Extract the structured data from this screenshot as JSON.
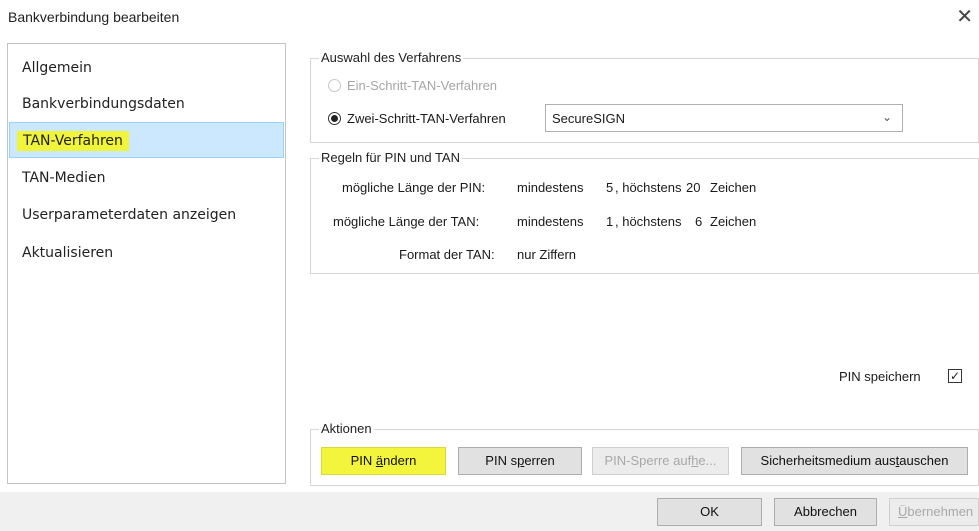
{
  "window": {
    "title": "Bankverbindung bearbeiten",
    "close_glyph": "✕"
  },
  "sidebar": {
    "items": [
      {
        "label": "Allgemein"
      },
      {
        "label": "Bankverbindungsdaten"
      },
      {
        "label": "TAN-Verfahren",
        "selected": true
      },
      {
        "label": "TAN-Medien"
      },
      {
        "label": "Userparameterdaten anzeigen"
      },
      {
        "label": "Aktualisieren"
      }
    ]
  },
  "verfahren": {
    "legend": "Auswahl des Verfahrens",
    "option_one": "Ein-Schritt-TAN-Verfahren",
    "option_two": "Zwei-Schritt-TAN-Verfahren",
    "selected_option": "Zwei-Schritt-TAN-Verfahren",
    "dropdown_value": "SecureSIGN"
  },
  "regeln": {
    "legend": "Regeln für PIN und TAN",
    "pin_label": "mögliche Länge der PIN:",
    "pin_min_label": "mindestens",
    "pin_min": "5",
    "pin_max_label": ", höchstens",
    "pin_max": "20",
    "pin_unit": "Zeichen",
    "tan_label": "mögliche Länge der TAN:",
    "tan_min_label": "mindestens",
    "tan_min": "1",
    "tan_max_label": ", höchstens",
    "tan_max": "6",
    "tan_unit": "Zeichen",
    "format_label": "Format der TAN:",
    "format_value": "nur Ziffern"
  },
  "pin_speichern": {
    "label": "PIN speichern",
    "checked": true
  },
  "aktionen": {
    "legend": "Aktionen",
    "pin_aendern": {
      "pre": "PIN ",
      "key": "ä",
      "post": "ndern"
    },
    "pin_sperren": {
      "pre": "PIN s",
      "key": "p",
      "post": "erren"
    },
    "pin_sperre_aufheben": {
      "pre": "PIN-Sperre auf",
      "key": "h",
      "post": "e..."
    },
    "sicherheitsmedium": {
      "pre": "Sicherheitsmedium aus",
      "key": "t",
      "post": "auschen"
    }
  },
  "footer": {
    "ok_label": "OK",
    "cancel_label": "Abbrechen",
    "apply": {
      "pre": "",
      "key": "Ü",
      "post": "bernehmen"
    }
  },
  "colors": {
    "highlight": "#f0f43a",
    "selection_bg": "#cce8ff",
    "selection_border": "#99d1ff"
  }
}
